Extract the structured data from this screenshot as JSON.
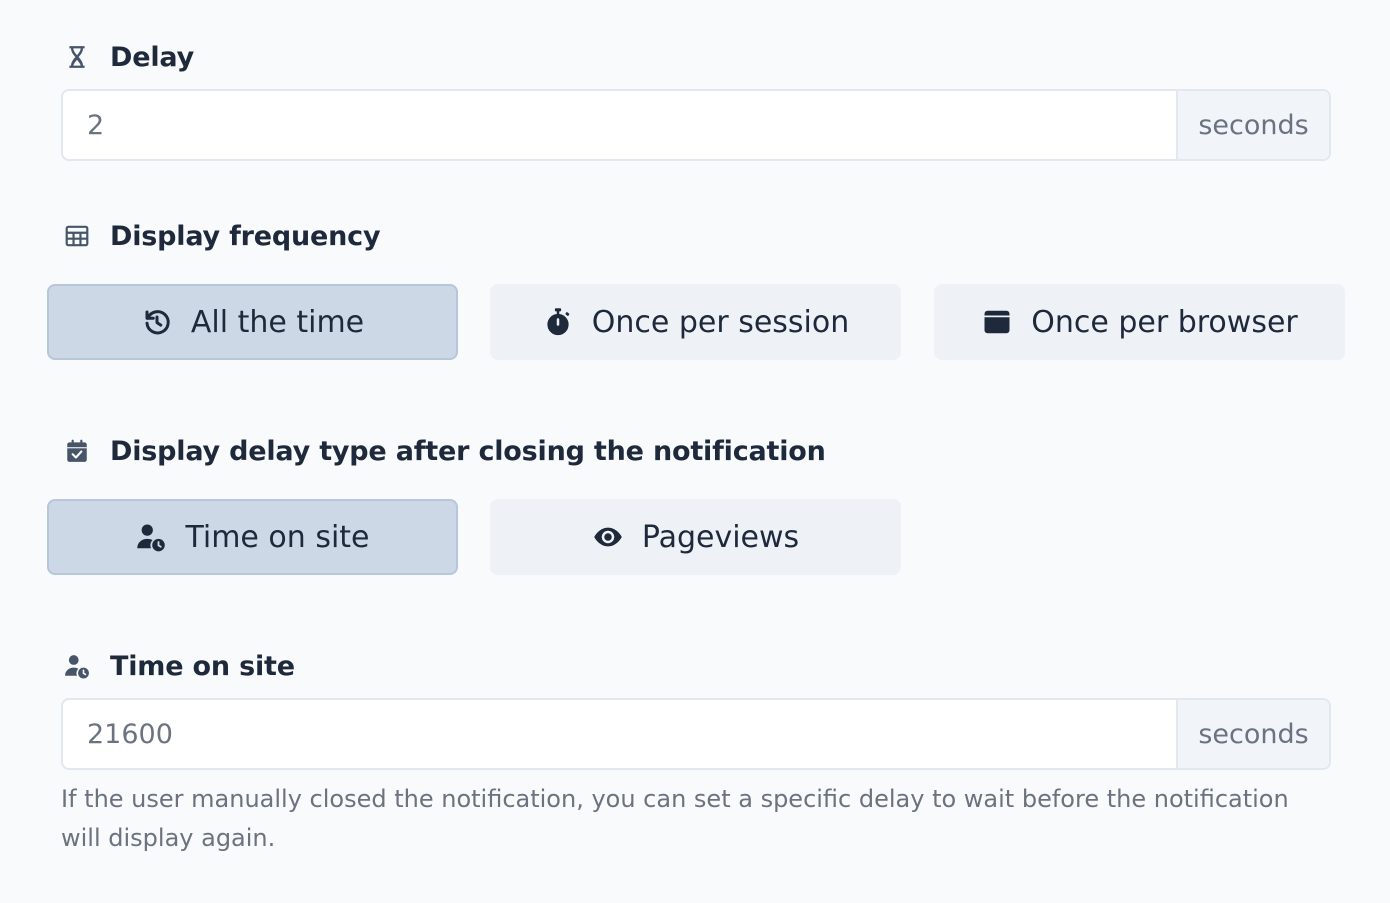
{
  "delay": {
    "label": "Delay",
    "value": "2",
    "unit": "seconds",
    "icon": "hourglass-icon"
  },
  "display_frequency": {
    "label": "Display frequency",
    "icon": "table-icon",
    "options": [
      {
        "label": "All the time",
        "icon": "history-icon",
        "selected": true
      },
      {
        "label": "Once per session",
        "icon": "stopwatch-icon",
        "selected": false
      },
      {
        "label": "Once per browser",
        "icon": "browser-window-icon",
        "selected": false
      }
    ]
  },
  "delay_type": {
    "label": "Display delay type after closing the notification",
    "icon": "calendar-check-icon",
    "options": [
      {
        "label": "Time on site",
        "icon": "user-clock-icon",
        "selected": true
      },
      {
        "label": "Pageviews",
        "icon": "eye-icon",
        "selected": false
      }
    ]
  },
  "time_on_site": {
    "label": "Time on site",
    "icon": "user-clock-icon",
    "value": "21600",
    "unit": "seconds",
    "help": "If the user manually closed the notification, you can set a specific delay to wait before the notification will display again."
  },
  "colors": {
    "background": "#f8fafc",
    "option_active": "#cdd8e6",
    "option_inactive": "#eef2f6",
    "text": "#1e293b",
    "muted": "#6b7280"
  }
}
